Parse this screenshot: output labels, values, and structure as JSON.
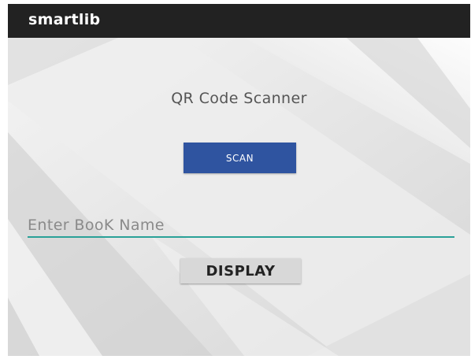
{
  "app_bar": {
    "title": "smartlib",
    "background": "#222222"
  },
  "main": {
    "heading": "QR Code Scanner",
    "scan_button": {
      "label": "SCAN",
      "color": "#2f54a0"
    },
    "book_input": {
      "value": "",
      "placeholder": "Enter BooK Name",
      "underline_color": "#2aa198"
    },
    "display_button": {
      "label": "DISPLAY"
    }
  }
}
